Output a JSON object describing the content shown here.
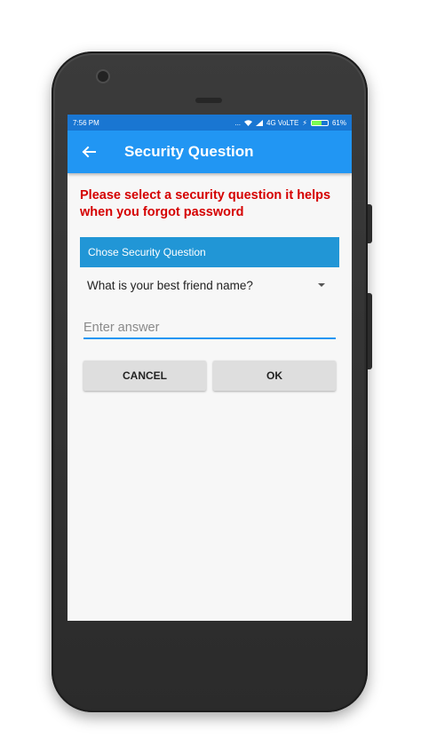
{
  "status_bar": {
    "time": "7:56 PM",
    "dots": "...",
    "network": "4G VoLTE",
    "battery_percent": "61%",
    "battery_level": 0.61,
    "battery_color": "#7cfc52"
  },
  "app_bar": {
    "back_icon": "arrow-left-icon",
    "title": "Security Question",
    "color": "#2196f3"
  },
  "content": {
    "instruction": "Please select a security question it helps when you forgot password",
    "instruction_color": "#d50000",
    "section_header": "Chose Security Question",
    "spinner": {
      "selected": "What is your best friend name?"
    },
    "answer": {
      "value": "",
      "placeholder": "Enter answer"
    },
    "buttons": {
      "cancel": "CANCEL",
      "ok": "OK"
    }
  }
}
